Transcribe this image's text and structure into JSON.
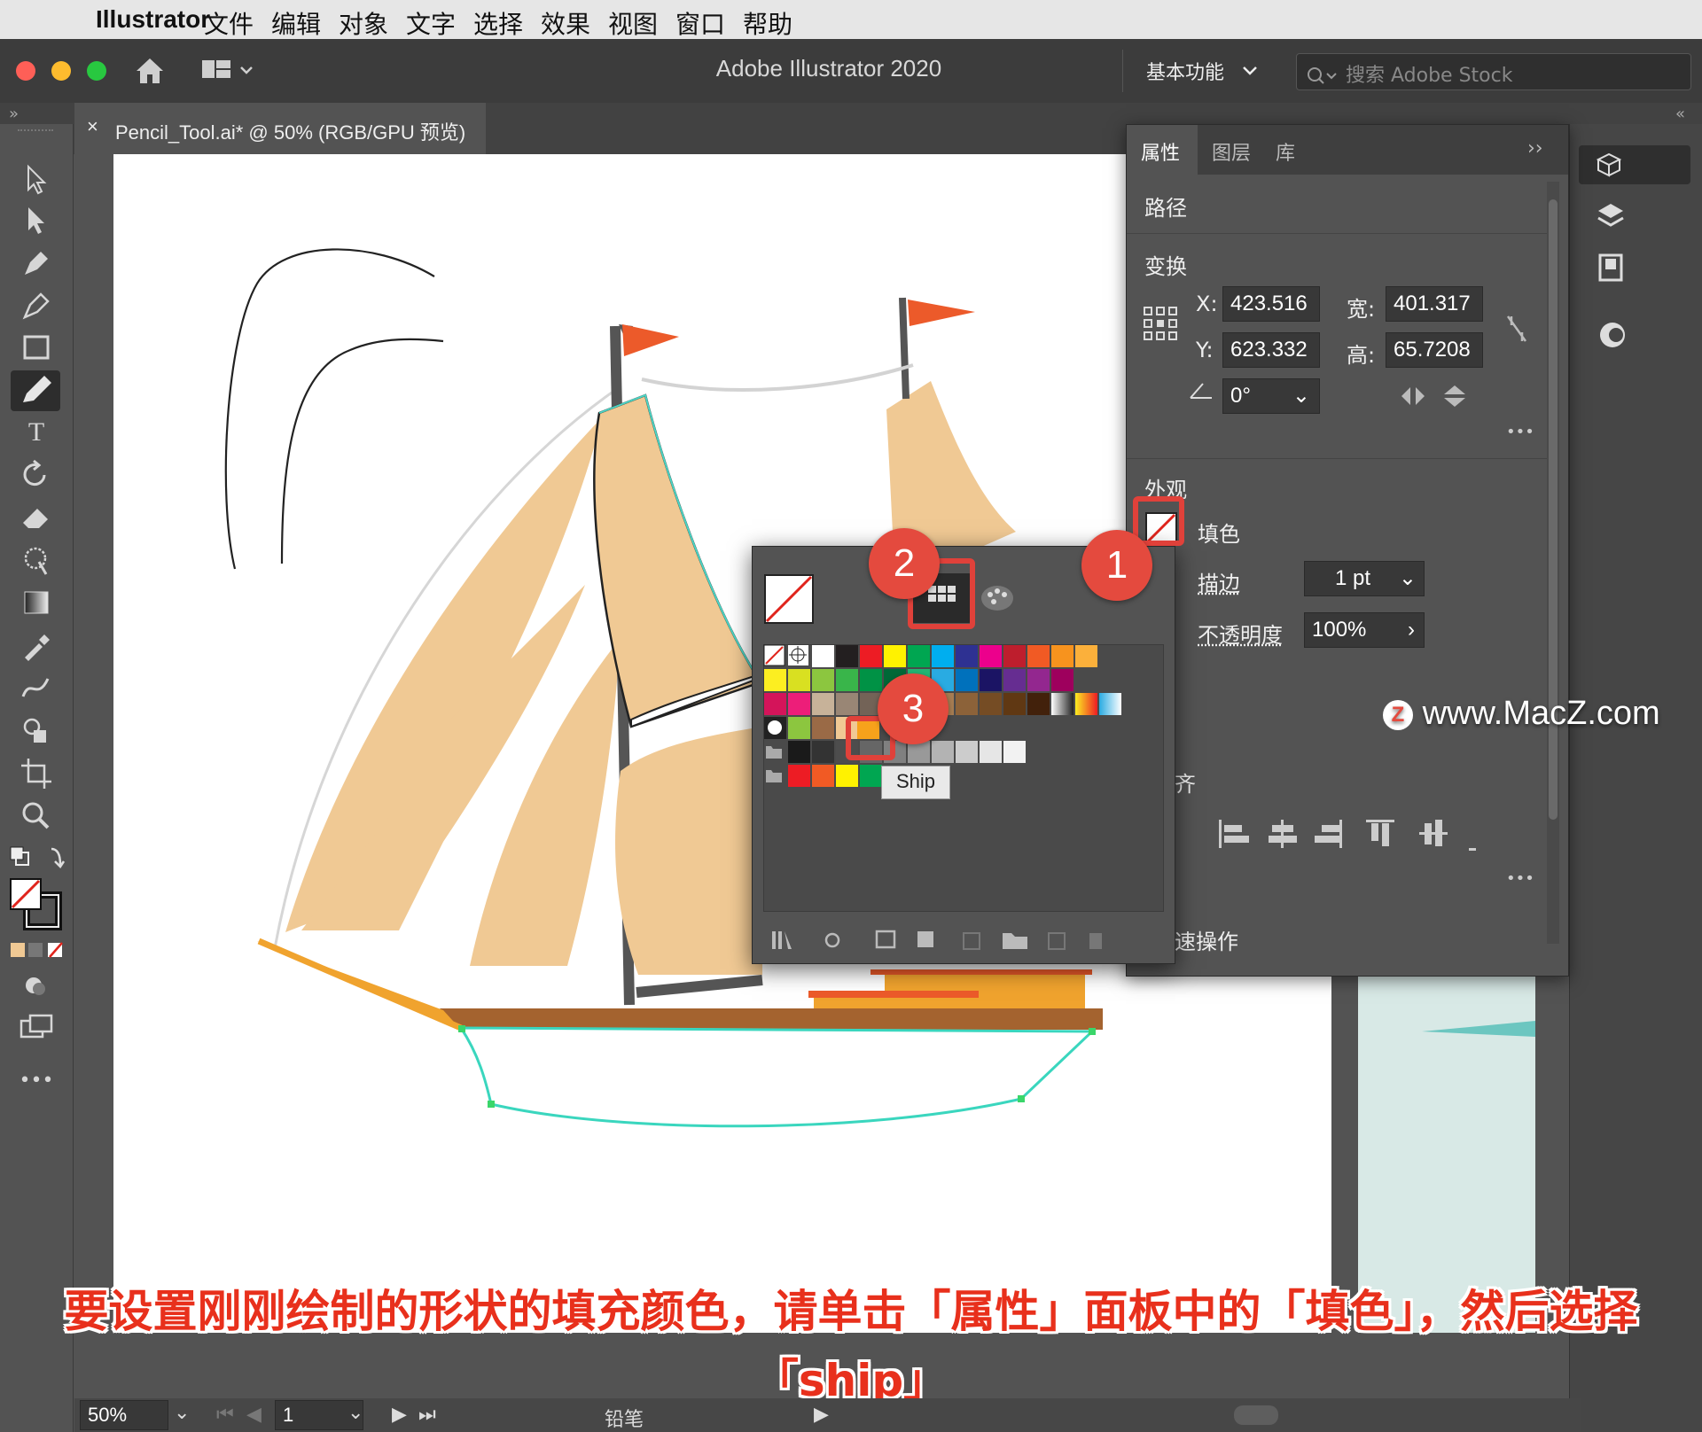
{
  "menubar": {
    "app_name": "Illustrator",
    "items": [
      "文件",
      "编辑",
      "对象",
      "文字",
      "选择",
      "效果",
      "视图",
      "窗口",
      "帮助"
    ]
  },
  "titlebar": {
    "title": "Adobe Illustrator 2020",
    "workspace": "基本功能",
    "search_placeholder": "搜索 Adobe Stock"
  },
  "document_tab": {
    "label": "Pencil_Tool.ai* @ 50% (RGB/GPU 预览)",
    "close": "×"
  },
  "properties_panel": {
    "tabs": [
      "属性",
      "图层",
      "库"
    ],
    "object_type": "路径",
    "transform": {
      "heading": "变换",
      "x_label": "X:",
      "x": "423.516",
      "y_label": "Y:",
      "y": "623.332",
      "w_label": "宽:",
      "w": "401.317",
      "h_label": "高:",
      "h": "65.7208",
      "angle": "0°"
    },
    "appearance": {
      "heading": "外观",
      "fill_label": "填色",
      "stroke_label": "描边",
      "stroke_value": "1 pt",
      "opacity_label": "不透明度",
      "opacity_value": "100%"
    },
    "align_partial": "齐",
    "quick_actions_partial": "速操作",
    "more": "•••"
  },
  "swatches_popup": {
    "tooltip": "Ship",
    "colors_row1": [
      "#ffffff",
      "#231f20",
      "#ed1c24",
      "#fff200",
      "#00a651",
      "#00aeef",
      "#2e3192",
      "#ec008c",
      "#be1e2d",
      "#f15a24",
      "#f7931e",
      "#fbb03b"
    ],
    "colors_row2": [
      "#fcee21",
      "#d9e021",
      "#8cc63f",
      "#39b54a",
      "#009245",
      "#006837",
      "#22b573",
      "#29abe2",
      "#0071bc",
      "#1b1464",
      "#662d91",
      "#93278f",
      "#9e005d"
    ],
    "colors_row3": [
      "#d4145a",
      "#ed1e79",
      "#c7b299",
      "#998675",
      "#736357",
      "#534741",
      "#c69c6d",
      "#a67c52",
      "#8c6239",
      "#754c24",
      "#603813",
      "#42210b"
    ],
    "ship_colors": [
      "#f0c994",
      "#f7a21b"
    ],
    "gray_group": [
      "#1a1a1a",
      "#333333",
      "#4d4d4d",
      "#666666",
      "#808080",
      "#999999",
      "#b3b3b3",
      "#cccccc",
      "#e6e6e6",
      "#f2f2f2"
    ],
    "bright_group": [
      "#ed1c24",
      "#f15a24",
      "#fff200",
      "#00a651"
    ]
  },
  "badges": [
    "1",
    "2",
    "3"
  ],
  "watermark": "www.MacZ.com",
  "status": {
    "zoom": "50%",
    "artboard": "1",
    "tool": "铅笔"
  },
  "caption": {
    "line1": "要设置刚刚绘制的形状的填充颜色，请单击「属性」面板中的「填色」，然后选择",
    "line2": "「ship」"
  }
}
